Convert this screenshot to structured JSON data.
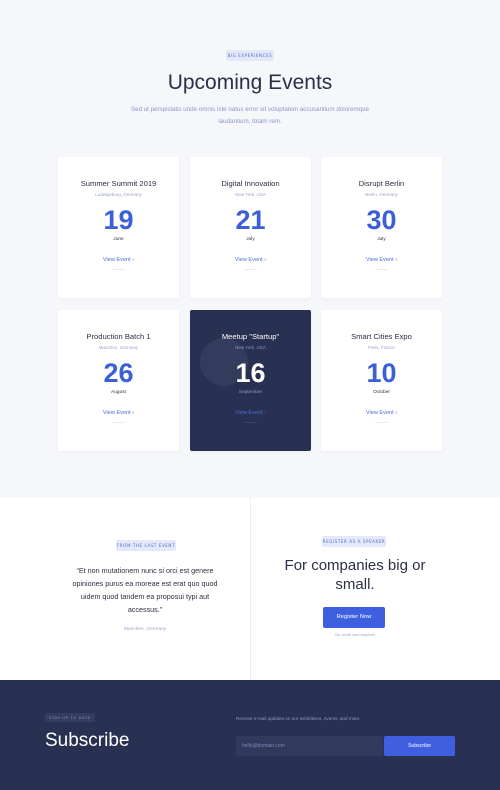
{
  "events_section": {
    "badge": "BIG EXPERIENCES",
    "title": "Upcoming Events",
    "subtitle": "Sed ut perspiciatis unde omnis iste natus error sit voluptatem accusantium doloremque laudantium, totam rem.",
    "events": [
      {
        "title": "Summer Summit 2019",
        "location": "Ludwigsburg, Germany",
        "day": "19",
        "month": "June",
        "link": "View Event ›"
      },
      {
        "title": "Digital Innovation",
        "location": "New York, USA",
        "day": "21",
        "month": "July",
        "link": "View Event ›"
      },
      {
        "title": "Disrupt Berlin",
        "location": "Berlin, Germany",
        "day": "30",
        "month": "July",
        "link": "View Event ›"
      },
      {
        "title": "Production Batch 1",
        "location": "Munchen, Germany",
        "day": "26",
        "month": "August",
        "link": "View Event ›"
      },
      {
        "title": "Meetup \"Startup\"",
        "location": "New York, USA",
        "day": "16",
        "month": "September",
        "link": "View Event ›"
      },
      {
        "title": "Smart Cities Expo",
        "location": "Paris, France",
        "day": "10",
        "month": "October",
        "link": "View Event ›"
      }
    ]
  },
  "testimonial": {
    "badge": "FROM THE LAST EVENT",
    "quote": "“Et non mutationem nunc si orci est genere opiniones purus ea moreae est erat quo quod uidem quod tandem ea proposui typi aut accessus.”",
    "source": "Munchen, Germany"
  },
  "promo": {
    "badge": "REGISTER AS A SPEAKER",
    "title": "For companies big or small.",
    "button": "Register Now",
    "note": "No credit card required"
  },
  "footer": {
    "badge": "STAY UP TO DATE",
    "title": "Subscribe",
    "note": "Receive e-mail updates on our exhibitions, events, and more.",
    "email_placeholder": "hello@domain.com",
    "button": "Subscribe"
  },
  "colors": {
    "accent": "#3d5fe0",
    "dark_navy": "#283152",
    "page_bg": "#f6f7fb"
  }
}
